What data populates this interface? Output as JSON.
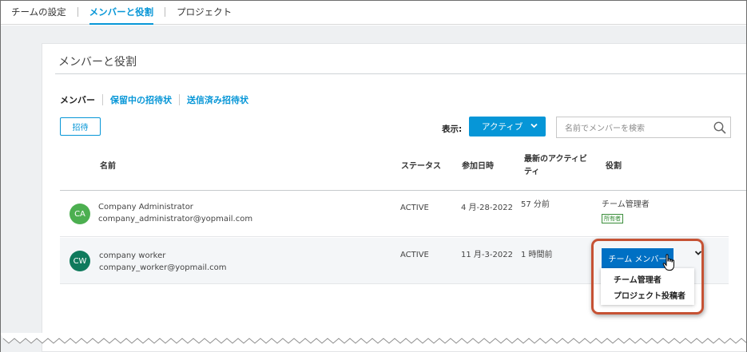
{
  "top_tabs": [
    {
      "label": "チームの設定"
    },
    {
      "label": "メンバーと役割"
    },
    {
      "label": "プロジェクト"
    }
  ],
  "card": {
    "title": "メンバーと役割",
    "subtabs": [
      {
        "label": "メンバー"
      },
      {
        "label": "保留中の招待状"
      },
      {
        "label": "送信済み招待状"
      }
    ],
    "invite_label": "招待",
    "show_label": "表示:",
    "filter_value": "アクティブ",
    "search_placeholder": "名前でメンバーを検索"
  },
  "table": {
    "headers": {
      "name": "名前",
      "status": "ステータス",
      "joined": "参加日時",
      "activity_line1": "最新のアクティビ",
      "activity_line2": "ティ",
      "role": "役割"
    },
    "rows": [
      {
        "initials": "CA",
        "avatar_color": "#4caf50",
        "name": "Company Administrator",
        "email": "company_administrator@yopmail.com",
        "status": "ACTIVE",
        "joined": "4 月-28-2022",
        "activity": "57 分前",
        "role": "チーム管理者",
        "badge": "所有者"
      },
      {
        "initials": "CW",
        "avatar_color": "#0f7a5c",
        "name": "company worker",
        "email": "company_worker@yopmail.com",
        "status": "ACTIVE",
        "joined": "11 月-3-2022",
        "activity": "1 時間前",
        "role_selected": "チーム メンバー",
        "role_options": [
          "チーム管理者",
          "プロジェクト投稿者"
        ]
      }
    ]
  },
  "colors": {
    "accent": "#0696d7",
    "highlight": "#c65234"
  }
}
